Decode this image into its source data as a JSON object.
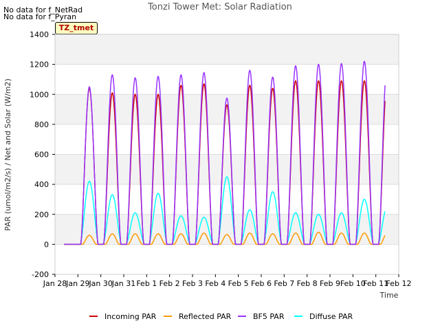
{
  "nodata_lines": [
    "No data for f_NetRad",
    "No data for f_Pyran"
  ],
  "tag": "TZ_tmet",
  "chart_data": {
    "type": "line",
    "title": "Tonzi Tower Met: Solar Radiation",
    "xlabel": "Time",
    "ylabel": "PAR (umol/m2/s) / Net and Solar (W/m2)",
    "ylim": [
      -200,
      1400
    ],
    "xlim": [
      0,
      15
    ],
    "yticks": [
      -200,
      0,
      200,
      400,
      600,
      800,
      1000,
      1200,
      1400
    ],
    "xtick_labels": [
      "Jan 28",
      "Jan 29",
      "Jan 30",
      "Jan 31",
      "Feb 1",
      "Feb 2",
      "Feb 3",
      "Feb 4",
      "Feb 5",
      "Feb 6",
      "Feb 7",
      "Feb 8",
      "Feb 9",
      "Feb 10",
      "Feb 11",
      "Feb 12"
    ],
    "grid": true,
    "legend_position": "bottom",
    "series": [
      {
        "name": "Incoming PAR",
        "color": "#cc0000",
        "daily_peaks": [
          1040,
          1010,
          1000,
          1000,
          1060,
          1070,
          930,
          1060,
          1040,
          1090,
          1090,
          1090,
          1090,
          1100
        ]
      },
      {
        "name": "Reflected PAR",
        "color": "#ff9900",
        "daily_peaks": [
          60,
          70,
          70,
          70,
          70,
          75,
          65,
          75,
          70,
          75,
          80,
          75,
          75,
          75
        ]
      },
      {
        "name": "BF5 PAR",
        "color": "#9933ff",
        "daily_peaks": [
          1050,
          1130,
          1110,
          1120,
          1130,
          1145,
          975,
          1160,
          1115,
          1190,
          1200,
          1205,
          1220,
          1220
        ]
      },
      {
        "name": "Diffuse PAR",
        "color": "#00ffff",
        "daily_peaks": [
          420,
          330,
          210,
          340,
          190,
          180,
          450,
          230,
          350,
          210,
          200,
          210,
          300,
          250
        ]
      }
    ]
  }
}
